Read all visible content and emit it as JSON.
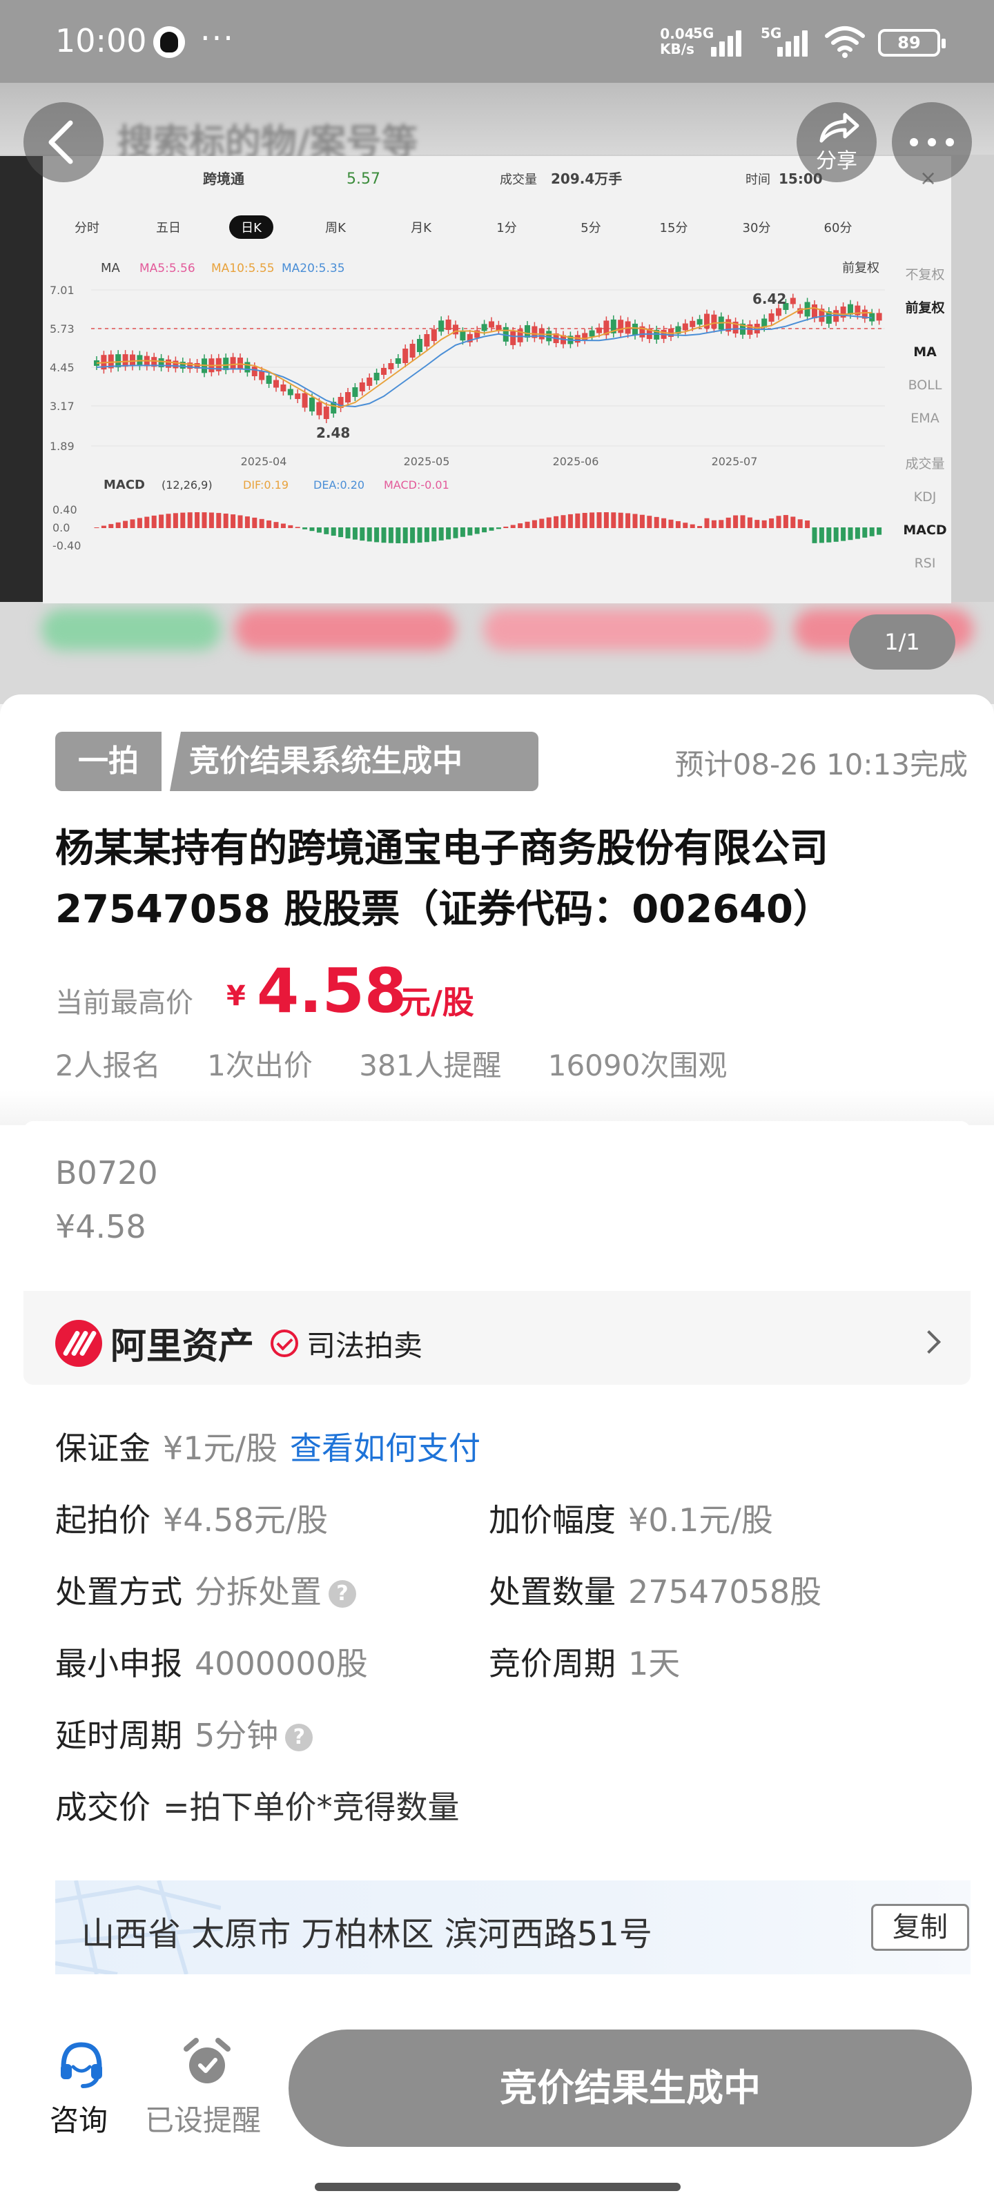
{
  "status_bar": {
    "time": "10:00",
    "more": "···",
    "net_speed": "0.04",
    "net_unit": "KB/s",
    "sig1": "5G",
    "sig2": "5G",
    "battery": "89"
  },
  "header": {
    "search_placeholder": "搜索标的物/案号等",
    "share_label": "分享"
  },
  "gallery": {
    "pager": "1/1",
    "chart": {
      "name": "跨境通",
      "price": "5.57",
      "volume_label": "成交量",
      "volume": "209.4万手",
      "time_label": "时间",
      "time": "15:00",
      "periods": [
        "分时",
        "五日",
        "日K",
        "周K",
        "月K",
        "1分",
        "5分",
        "15分",
        "30分",
        "60分"
      ],
      "active_period": "日K",
      "ma_labels": [
        "MA",
        "MA5:5.56",
        "MA10:5.55",
        "MA20:5.35"
      ],
      "adjust": "前复权",
      "side_options": [
        "不复权",
        "前复权",
        "MA",
        "BOLL",
        "EMA",
        "成交量",
        "KDJ",
        "MACD",
        "RSI"
      ],
      "y_ticks": [
        "7.01",
        "5.73",
        "4.45",
        "3.17",
        "1.89"
      ],
      "x_ticks": [
        "2025-04",
        "2025-05",
        "2025-06",
        "2025-07"
      ],
      "high_label": "6.42",
      "low_label": "2.48",
      "macd_label": "MACD",
      "macd_params": "(12,26,9)",
      "macd_values": [
        "DIF:0.19",
        "DEA:0.20",
        "MACD:-0.01"
      ],
      "macd_ticks": [
        "0.40",
        "0.0",
        "-0.40"
      ]
    }
  },
  "auction": {
    "tag_mode": "一拍",
    "tag_status": "竞价结果系统生成中",
    "eta": "预计08-26 10:13完成",
    "title": "杨某某持有的跨境通宝电子商务股份有限公司27547058 股股票（证券代码：002640）",
    "price_label": "当前最高价",
    "currency": "¥",
    "price": "4.58",
    "price_unit": "元/股",
    "stats": [
      "2人报名",
      "1次出价",
      "381人提醒",
      "16090次围观"
    ]
  },
  "bid": {
    "code": "B0720",
    "price": "¥4.58"
  },
  "seller": {
    "name": "阿里资产",
    "type": "司法拍卖"
  },
  "details": {
    "deposit_k": "保证金",
    "deposit_v": "¥1元/股",
    "deposit_link": "查看如何支付",
    "start_k": "起拍价",
    "start_v": "¥4.58元/股",
    "step_k": "加价幅度",
    "step_v": "¥0.1元/股",
    "method_k": "处置方式",
    "method_v": "分拆处置",
    "qty_k": "处置数量",
    "qty_v": "27547058股",
    "min_k": "最小申报",
    "min_v": "4000000股",
    "cycle_k": "竞价周期",
    "cycle_v": "1天",
    "delay_k": "延时周期",
    "delay_v": "5分钟",
    "deal_k": "成交价",
    "deal_v": "=拍下单价*竞得数量",
    "address": "山西省 太原市 万柏林区 滨河西路51号",
    "copy": "复制"
  },
  "bottom": {
    "consult": "咨询",
    "reminder": "已设提醒",
    "main_button": "竞价结果生成中"
  },
  "colors": {
    "accent_red": "#e8183a",
    "link_blue": "#1e73d8",
    "disabled_gray": "#8e8e8e"
  }
}
